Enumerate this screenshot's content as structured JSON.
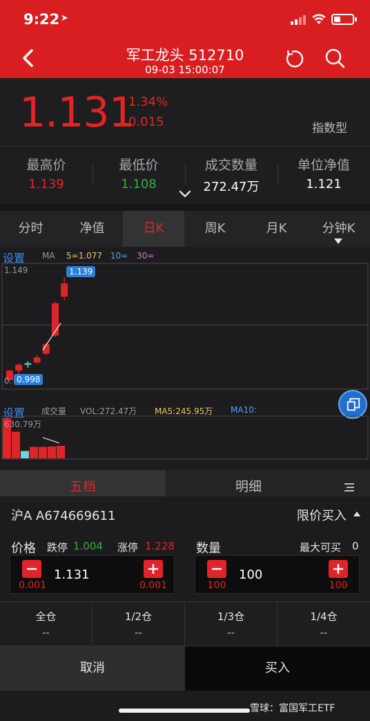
{
  "status": {
    "time": "9:22"
  },
  "nav": {
    "title": "军工龙头 512710",
    "datetime": "09-03 15:00:07"
  },
  "quote": {
    "price": "1.131",
    "change_pct": "1.34%",
    "change": "0.015",
    "fund_type": "指数型"
  },
  "stats": [
    {
      "label": "最高价",
      "value": "1.139",
      "color": "#e32424"
    },
    {
      "label": "最低价",
      "value": "1.108",
      "color": "#2fb13c"
    },
    {
      "label": "成交数量",
      "value": "272.47万",
      "color": "#ffffff"
    },
    {
      "label": "单位净值",
      "value": "1.121",
      "color": "#ffffff"
    }
  ],
  "chart_tabs": [
    {
      "label": "分时",
      "active": false
    },
    {
      "label": "净值",
      "active": false
    },
    {
      "label": "日K",
      "active": true
    },
    {
      "label": "周K",
      "active": false
    },
    {
      "label": "月K",
      "active": false
    },
    {
      "label": "分钟K",
      "active": false
    }
  ],
  "kline": {
    "settings": "设置",
    "ma_label": "MA",
    "ma5": "5=1.077",
    "ma10": "10=",
    "ma30": "30=",
    "high_axis": "1.149",
    "high_tag": "1.139",
    "low_tag": "0.998",
    "low_axis_partial": "0."
  },
  "volume": {
    "settings": "设置",
    "label": "成交量",
    "vol": "VOL:272.47万",
    "ma5": "MA5:245.95万",
    "ma10": "MA10:",
    "max_axis": "630.79万"
  },
  "chart_data": [
    {
      "type": "candlestick",
      "title": "",
      "ylim_labels": [
        "0.998",
        "1.149"
      ],
      "candles": [
        {
          "open": 1.012,
          "close": 0.999,
          "high": 1.013,
          "low": 0.998,
          "direction": "up"
        },
        {
          "open": 1.012,
          "close": 1.02,
          "high": 1.022,
          "low": 1.008,
          "direction": "up"
        },
        {
          "open": 1.022,
          "close": 1.021,
          "high": 1.025,
          "low": 1.016,
          "direction": "doji"
        },
        {
          "open": 1.023,
          "close": 1.03,
          "high": 1.034,
          "low": 1.021,
          "direction": "up"
        },
        {
          "open": 1.035,
          "close": 1.048,
          "high": 1.05,
          "low": 1.033,
          "direction": "up"
        },
        {
          "open": 1.06,
          "close": 1.104,
          "high": 1.106,
          "low": 1.058,
          "direction": "up"
        },
        {
          "open": 1.113,
          "close": 1.131,
          "high": 1.139,
          "low": 1.108,
          "direction": "up"
        }
      ],
      "ma5_line": [
        1.04,
        1.077
      ]
    },
    {
      "type": "bar",
      "title": "",
      "ymax_label": "630.79万",
      "values": [
        630.79,
        580,
        160,
        250,
        250,
        260,
        272.47
      ],
      "colors": [
        "#e0252a",
        "#e0252a",
        "#6fd6e0",
        "#e0252a",
        "#e0252a",
        "#e0252a",
        "#e0252a"
      ]
    }
  ],
  "depth_tabs": [
    {
      "label": "五档",
      "active": true
    },
    {
      "label": "明细",
      "active": false
    }
  ],
  "trade": {
    "account": "沪A A674669611",
    "order_type": "限价买入",
    "price_label": "价格",
    "limit_down_label": "跌停",
    "limit_down": "1.004",
    "limit_up_label": "涨停",
    "limit_up": "1.228",
    "price_value": "1.131",
    "price_step": "0.001",
    "qty_label": "数量",
    "max_buy_label": "最大可买",
    "max_buy": "0",
    "qty_value": "100",
    "qty_step": "100",
    "positions": [
      {
        "label": "全仓",
        "value": "--"
      },
      {
        "label": "1/2仓",
        "value": "--"
      },
      {
        "label": "1/3仓",
        "value": "--"
      },
      {
        "label": "1/4仓",
        "value": "--"
      }
    ],
    "cancel": "取消",
    "buy": "买入"
  },
  "watermark": "雪球：富国军工ETF"
}
